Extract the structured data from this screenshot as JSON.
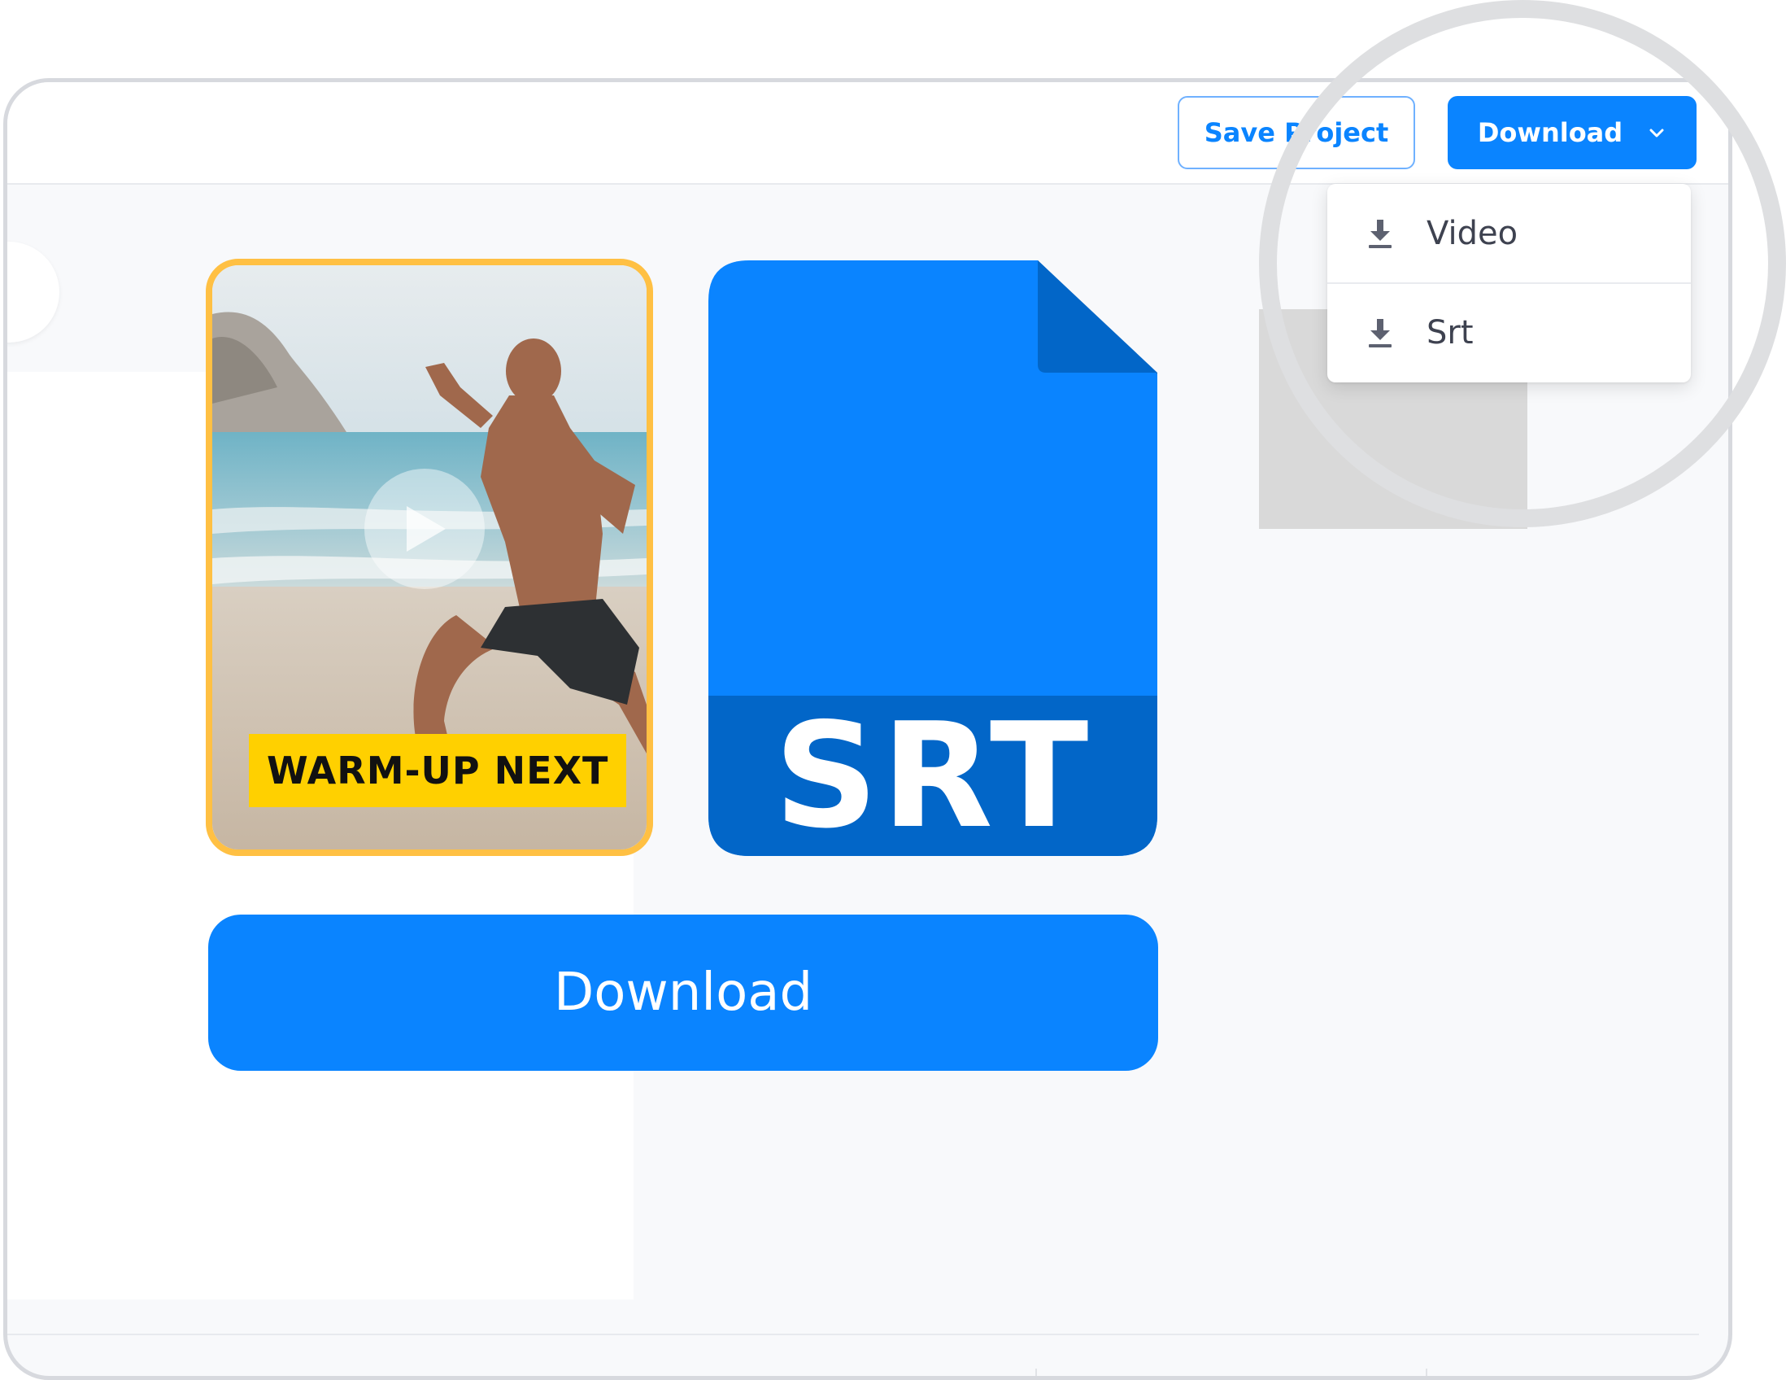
{
  "toolbar": {
    "save_label": "Save Project",
    "download_label": "Download"
  },
  "dropdown": {
    "items": [
      {
        "label": "Video",
        "icon": "download-icon"
      },
      {
        "label": "Srt",
        "icon": "download-icon"
      }
    ]
  },
  "preview": {
    "caption": "WARM-UP NEXT",
    "play_icon": "play-icon"
  },
  "file_icon": {
    "label": "SRT"
  },
  "main": {
    "download_label": "Download"
  },
  "colors": {
    "accent": "#0a84ff",
    "file_body": "#0a84ff",
    "file_band": "#0266c8",
    "card_border": "#ffc043",
    "caption_bg": "#ffd000"
  }
}
